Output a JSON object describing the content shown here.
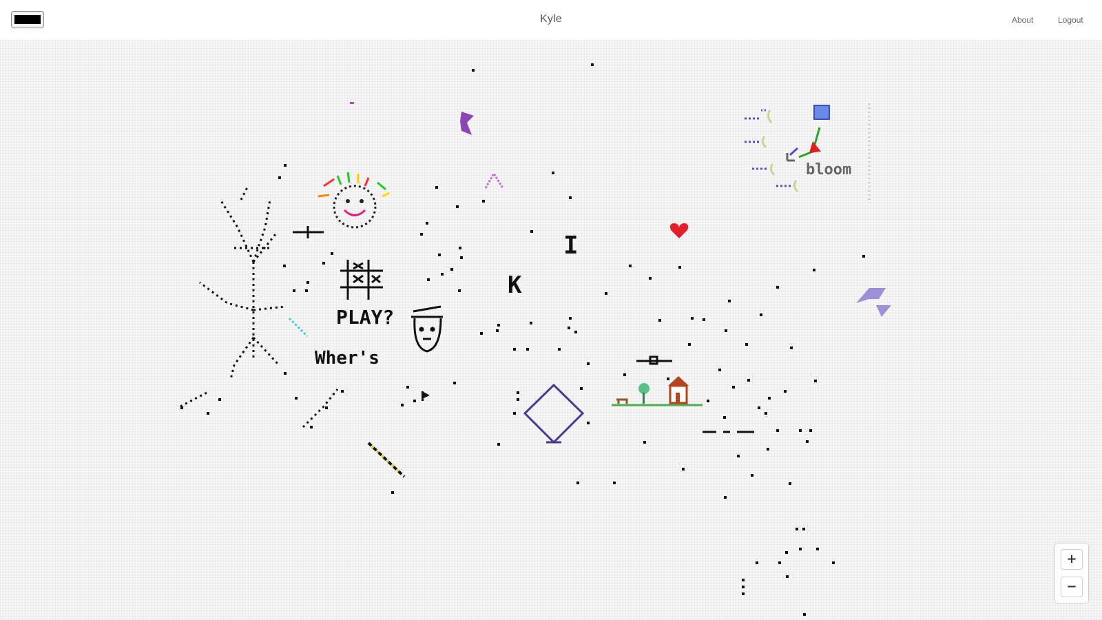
{
  "header": {
    "title": "Kyle",
    "nav": {
      "about": "About",
      "logout": "Logout"
    },
    "current_color": "#000000"
  },
  "canvas": {
    "texts": {
      "play": "PLAY?",
      "whers": "Wher's",
      "bloom": "bloom",
      "letter_k": "K",
      "letter_i": "I"
    }
  },
  "zoom": {
    "in_label": "+",
    "out_label": "−"
  },
  "colors": {
    "purple": "#8b45b5",
    "lavender": "#9f8fd8",
    "heart": "#e0202a",
    "diamond": "#4a3a90",
    "grass": "#4caf50",
    "house": "#b5441c",
    "dots": "#111111"
  }
}
